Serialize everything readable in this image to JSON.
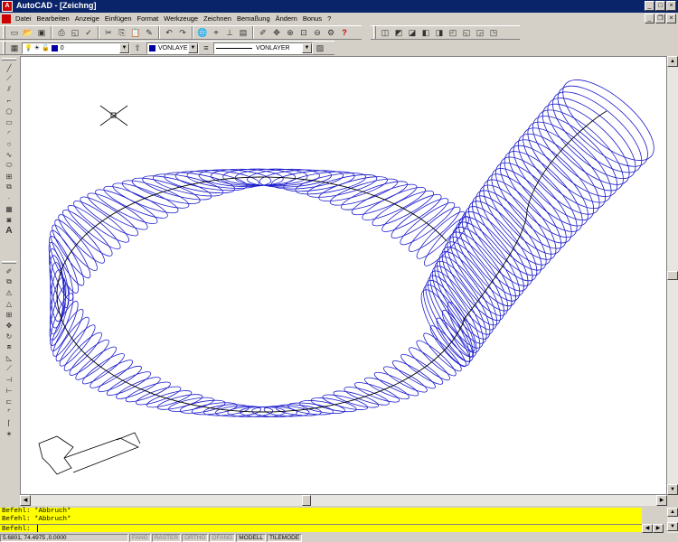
{
  "window": {
    "title": "AutoCAD - [Zeichng]",
    "app_icon": "autocad-icon",
    "controls": [
      "_",
      "□",
      "×"
    ]
  },
  "menu": {
    "items": [
      {
        "label": "Datei",
        "ul": "D"
      },
      {
        "label": "Bearbeiten",
        "ul": "B"
      },
      {
        "label": "Anzeige",
        "ul": "A"
      },
      {
        "label": "Einfügen",
        "ul": "E"
      },
      {
        "label": "Format",
        "ul": "F"
      },
      {
        "label": "Werkzeuge",
        "ul": "W"
      },
      {
        "label": "Zeichnen",
        "ul": "Z"
      },
      {
        "label": "Bemaßung",
        "ul": "m"
      },
      {
        "label": "Ändern",
        "ul": "Ä"
      },
      {
        "label": "Bonus",
        "ul": "B"
      },
      {
        "label": "?",
        "ul": "?"
      }
    ]
  },
  "layer_toolbar": {
    "layer_name": "0",
    "color_value": "VONLAYER",
    "linetype_value": "VONLAYER",
    "layer_color": "#0000a0"
  },
  "command_window": {
    "lines": [
      "Befehl:  *Abbruch*",
      "Befehl:  *Abbruch*",
      "Befehl:"
    ],
    "background": "#ffff00"
  },
  "status": {
    "coordinates": "5.6801, 74.4975 ,0.0000",
    "toggles": [
      {
        "label": "FANG",
        "on": false
      },
      {
        "label": "RASTER",
        "on": false
      },
      {
        "label": "ORTHO",
        "on": false
      },
      {
        "label": "OFANG",
        "on": false
      },
      {
        "label": "MODELL",
        "on": true
      },
      {
        "label": "TILEMODE",
        "on": true
      }
    ]
  },
  "drawing": {
    "wire_color": "#1a1acc",
    "path_color": "#000000"
  }
}
